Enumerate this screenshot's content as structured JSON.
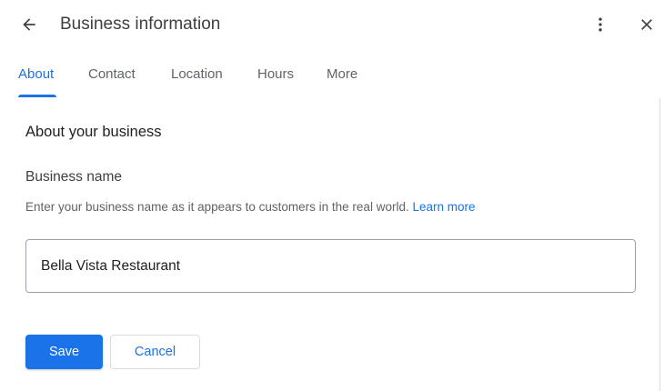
{
  "header": {
    "title": "Business information",
    "back_icon": "arrow-back-icon",
    "more_icon": "more-vert-icon",
    "close_icon": "close-icon"
  },
  "tabs": [
    {
      "label": "About",
      "active": true
    },
    {
      "label": "Contact",
      "active": false
    },
    {
      "label": "Location",
      "active": false
    },
    {
      "label": "Hours",
      "active": false
    },
    {
      "label": "More",
      "active": false
    }
  ],
  "section": {
    "heading": "About your business",
    "field_label": "Business name",
    "help_text": "Enter your business name as it appears to customers in the real world.",
    "learn_more": "Learn more",
    "business_name_value": "Bella Vista Restaurant"
  },
  "actions": {
    "save_label": "Save",
    "cancel_label": "Cancel"
  },
  "colors": {
    "accent": "#1a73e8",
    "text_primary": "#202124",
    "text_secondary": "#5f6368"
  }
}
